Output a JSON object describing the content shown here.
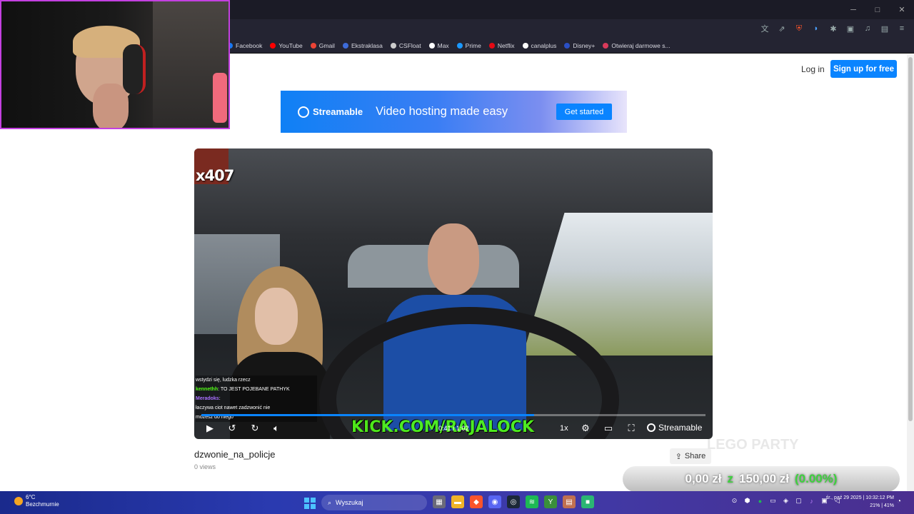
{
  "window": {
    "controls": [
      "─",
      "□",
      "✕"
    ]
  },
  "bookmarks": [
    {
      "label": "Facebook",
      "color": "#1877f2"
    },
    {
      "label": "YouTube",
      "color": "#ff0000"
    },
    {
      "label": "Gmail",
      "color": "#ea4335"
    },
    {
      "label": "Ekstraklasa",
      "color": "#3d6bd8"
    },
    {
      "label": "CSFloat",
      "color": "#cccccc"
    },
    {
      "label": "Max",
      "color": "#ffffff"
    },
    {
      "label": "Prime",
      "color": "#1a98ff"
    },
    {
      "label": "Netflix",
      "color": "#e50914"
    },
    {
      "label": "canalplus",
      "color": "#ffffff"
    },
    {
      "label": "Disney+",
      "color": "#2a4fc4"
    },
    {
      "label": "Otwieraj darmowe s...",
      "color": "#d83a5a"
    }
  ],
  "header": {
    "login": "Log in",
    "signup": "Sign up for free"
  },
  "banner": {
    "brand": "Streamable",
    "tagline": "Video hosting made easy",
    "cta": "Get started"
  },
  "player": {
    "badge": "x407",
    "chat": [
      {
        "user": "",
        "text": "wstydzi się, ludzka rzecz",
        "color": "#ff5050"
      },
      {
        "user": "kennethh",
        "text": ": TO JEST POJEBANE PATHYK",
        "color": "#53fc18"
      },
      {
        "user": "Meradoks",
        "text": ":",
        "color": "#a970ff"
      },
      {
        "user": "",
        "text": "łaczywa ciot nawet zadzwonić nie",
        "color": "#9aa0ff"
      },
      {
        "user": "",
        "text": "możesz do niego",
        "color": "#ffffff"
      }
    ],
    "watermark": "KICK.COM/RAJALOCK",
    "progress": 0.66,
    "time": "0:41 / 1:02",
    "speed": "1x",
    "brand": "Streamable"
  },
  "video": {
    "title": "dzwonie_na_policje",
    "views": "0 views",
    "share": "Share"
  },
  "overlay": {
    "lego": "LEGO PARTY",
    "amount_left": "0,00 zł",
    "separator": "z",
    "amount_right": "150,00 zł",
    "percent": "(0.00%)"
  },
  "taskbar": {
    "weather_temp": "6°C",
    "weather_desc": "Bezchmurnie",
    "search_placeholder": "Wyszukaj",
    "clock_date": "śr., paź 29 2025 | 10:32:12 PM",
    "clock_stats": "21% | 41%"
  }
}
